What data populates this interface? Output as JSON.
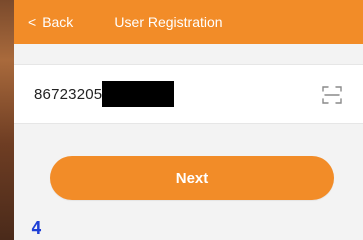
{
  "header": {
    "back_label": "Back",
    "title": "User Registration",
    "accent_color": "#f28c28"
  },
  "form": {
    "phone_value_visible": "86723205",
    "redacted": true,
    "scan_icon": "scan-icon"
  },
  "actions": {
    "next_label": "Next"
  },
  "overlay": {
    "step_number": "4",
    "color": "#1e3fd6"
  }
}
